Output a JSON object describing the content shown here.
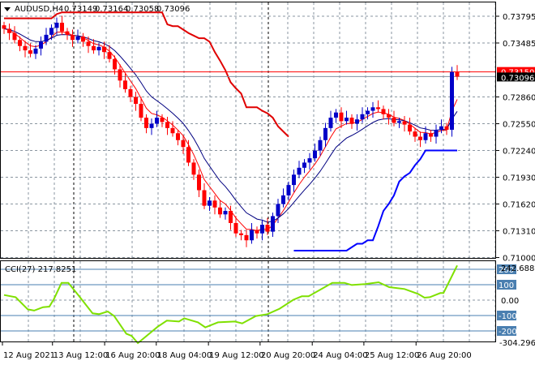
{
  "header": {
    "symbol": "AUDUSD,H4",
    "open": "0.73149",
    "high": "0.73164",
    "low": "0.73058",
    "close": "0.73096"
  },
  "colors": {
    "bull": "#0000c8",
    "bear": "#ff0000",
    "ema_fast": "#ff0000",
    "ema_slow": "#000080",
    "upper": "#e00000",
    "lower": "#0000ff",
    "cci": "#7fe000",
    "level": "#4a7fb0"
  },
  "chart_data": [
    {
      "type": "candlestick",
      "title": "AUDUSD,H4",
      "ylim": [
        0.71,
        0.7393
      ],
      "y_ticks": [
        "0.73795",
        "0.73485",
        "0.72860",
        "0.72550",
        "0.72240",
        "0.71930",
        "0.71620",
        "0.71310",
        "0.71000"
      ],
      "price_labels": {
        "ask": "0.73150",
        "bid": "0.73096"
      },
      "x_ticks": [
        {
          "bar": 0,
          "label": "12 Aug 2021"
        },
        {
          "bar": 9.5,
          "label": "13 Aug 12:00"
        },
        {
          "bar": 19.4,
          "label": "16 Aug 20:00"
        },
        {
          "bar": 29.2,
          "label": "18 Aug 04:00"
        },
        {
          "bar": 39.1,
          "label": "19 Aug 12:00"
        },
        {
          "bar": 48.9,
          "label": "20 Aug 20:00"
        },
        {
          "bar": 58.8,
          "label": "24 Aug 04:00"
        },
        {
          "bar": 68.6,
          "label": "25 Aug 12:00"
        },
        {
          "bar": 78.5,
          "label": "26 Aug 20:00"
        }
      ],
      "closes": [
        0.7365,
        0.736,
        0.7352,
        0.7345,
        0.734,
        0.7336,
        0.7342,
        0.735,
        0.7358,
        0.7366,
        0.7372,
        0.7362,
        0.7358,
        0.7352,
        0.7356,
        0.735,
        0.7345,
        0.734,
        0.7344,
        0.7338,
        0.733,
        0.7318,
        0.7305,
        0.7295,
        0.7286,
        0.7278,
        0.7262,
        0.725,
        0.7255,
        0.7262,
        0.7257,
        0.725,
        0.7244,
        0.7236,
        0.7228,
        0.721,
        0.7196,
        0.7178,
        0.716,
        0.7166,
        0.7158,
        0.715,
        0.7154,
        0.714,
        0.7128,
        0.7126,
        0.712,
        0.7132,
        0.7128,
        0.7138,
        0.713,
        0.7148,
        0.7162,
        0.7172,
        0.7184,
        0.7196,
        0.7204,
        0.721,
        0.7215,
        0.7224,
        0.7236,
        0.725,
        0.7262,
        0.7268,
        0.7258,
        0.7262,
        0.7255,
        0.726,
        0.7266,
        0.727,
        0.7274,
        0.7272,
        0.7266,
        0.7262,
        0.7256,
        0.7258,
        0.7254,
        0.7246,
        0.724,
        0.7236,
        0.7244,
        0.724,
        0.7248,
        0.7252,
        0.7248,
        0.73149,
        0.73096
      ]
    },
    {
      "type": "line",
      "title": "CCI(27) 217.8251",
      "ylim": [
        -304.2964,
        242.688
      ],
      "y_max_label": "242.688",
      "y_min_label": "-304.2964",
      "levels": [
        {
          "v": 200,
          "label": "200"
        },
        {
          "v": 100,
          "label": "100"
        },
        {
          "v": -100,
          "label": "-100"
        },
        {
          "v": -200,
          "label": "-200"
        }
      ],
      "zero_label": "0.00",
      "points": [
        [
          0,
          33
        ],
        [
          2.2,
          19
        ],
        [
          4.5,
          -60
        ],
        [
          5.7,
          -68
        ],
        [
          7.4,
          -46
        ],
        [
          8.6,
          -42
        ],
        [
          9.5,
          10
        ],
        [
          10.9,
          112
        ],
        [
          12.2,
          112
        ],
        [
          14.2,
          28
        ],
        [
          16.8,
          -86
        ],
        [
          18,
          -91
        ],
        [
          19.7,
          -74
        ],
        [
          20.9,
          -103
        ],
        [
          23.2,
          -218
        ],
        [
          24.2,
          -232
        ],
        [
          25.4,
          -279
        ],
        [
          29.1,
          -174
        ],
        [
          30.9,
          -133
        ],
        [
          33.2,
          -139
        ],
        [
          34.2,
          -118
        ],
        [
          36.8,
          -144
        ],
        [
          38.2,
          -177
        ],
        [
          40.6,
          -144
        ],
        [
          43.8,
          -139
        ],
        [
          45.2,
          -151
        ],
        [
          47.8,
          -103
        ],
        [
          50,
          -91
        ],
        [
          52.3,
          -56
        ],
        [
          54.9,
          2
        ],
        [
          56.5,
          25
        ],
        [
          57.8,
          25
        ],
        [
          62.3,
          112
        ],
        [
          64.6,
          112
        ],
        [
          66,
          98
        ],
        [
          68.5,
          104
        ],
        [
          71.1,
          116
        ],
        [
          73.1,
          84
        ],
        [
          76,
          72
        ],
        [
          78.6,
          40
        ],
        [
          79.8,
          16
        ],
        [
          80.8,
          19
        ],
        [
          82.8,
          46
        ],
        [
          83.4,
          46
        ],
        [
          84.8,
          142
        ],
        [
          86,
          225
        ]
      ]
    }
  ]
}
